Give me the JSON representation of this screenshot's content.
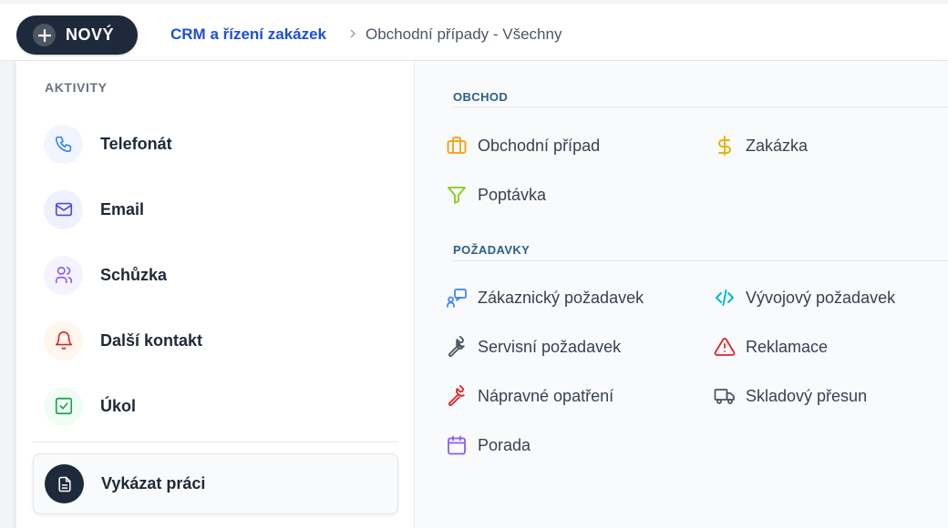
{
  "topbar": {
    "new_button": "NOVÝ",
    "breadcrumb_app": "CRM a řízení zakázek",
    "breadcrumb_page": "Obchodní případy - Všechny"
  },
  "activities": {
    "title": "AKTIVITY",
    "items": [
      {
        "label": "Telefonát",
        "icon": "phone-icon",
        "color": "#3b82f6",
        "bg": "#eff6ff"
      },
      {
        "label": "Email",
        "icon": "mail-icon",
        "color": "#4f46e5",
        "bg": "#eef2ff"
      },
      {
        "label": "Schůzka",
        "icon": "users-icon",
        "color": "#8b5cf6",
        "bg": "#f5f3ff"
      },
      {
        "label": "Další kontakt",
        "icon": "bell-icon",
        "color": "#dc2626",
        "bg": "#fff7ed"
      },
      {
        "label": "Úkol",
        "icon": "check-square-icon",
        "color": "#16a34a",
        "bg": "#f0fdf4"
      }
    ],
    "work_report": "Vykázat práci"
  },
  "obchod": {
    "title": "OBCHOD",
    "items": [
      {
        "label": "Obchodní případ",
        "icon": "briefcase-icon",
        "color": "#f59e0b"
      },
      {
        "label": "Zakázka",
        "icon": "dollar-icon",
        "color": "#eab308"
      },
      {
        "label": "Poptávka",
        "icon": "filter-icon",
        "color": "#84cc16"
      }
    ]
  },
  "pozadavky": {
    "title": "POŽADAVKY",
    "items": [
      {
        "label": "Zákaznický požadavek",
        "icon": "customer-request-icon",
        "color": "#3b82f6"
      },
      {
        "label": "Vývojový požadavek",
        "icon": "code-icon",
        "color": "#06b6d4"
      },
      {
        "label": "Servisní požadavek",
        "icon": "wrench-icon",
        "color": "#4b5563"
      },
      {
        "label": "Reklamace",
        "icon": "warning-icon",
        "color": "#dc2626"
      },
      {
        "label": "Nápravné opatření",
        "icon": "wrench-icon",
        "color": "#dc2626"
      },
      {
        "label": "Skladový přesun",
        "icon": "truck-icon",
        "color": "#4b5563"
      },
      {
        "label": "Porada",
        "icon": "calendar-icon",
        "color": "#8b5cf6"
      }
    ]
  }
}
